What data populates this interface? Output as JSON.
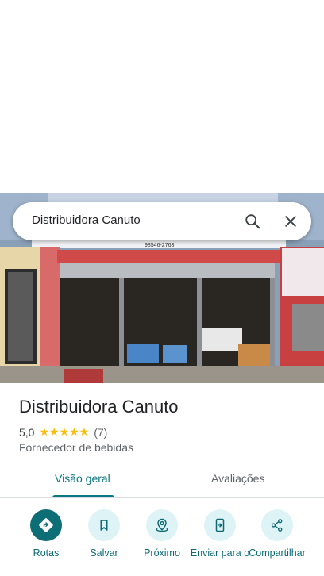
{
  "search": {
    "query": "Distribuidora Canuto"
  },
  "photo": {
    "sign_text": "98546-2763",
    "icons": [
      "storefront-photo"
    ]
  },
  "place": {
    "name": "Distribuidora Canuto",
    "rating": "5,0",
    "stars": "★★★★★",
    "review_count": "(7)",
    "category": "Fornecedor de bebidas"
  },
  "tabs": [
    {
      "label": "Visão geral",
      "active": true
    },
    {
      "label": "Avaliações",
      "active": false
    }
  ],
  "actions": [
    {
      "label": "Rotas",
      "icon": "directions-icon"
    },
    {
      "label": "Salvar",
      "icon": "bookmark-icon"
    },
    {
      "label": "Próximo",
      "icon": "nearby-icon"
    },
    {
      "label": "Enviar para o",
      "icon": "send-to-phone-icon"
    },
    {
      "label": "Compartilhar",
      "icon": "share-icon"
    }
  ],
  "colors": {
    "accent": "#0b7782",
    "action_bg": "#def3f5",
    "primary_action": "#0d6e76",
    "star": "#fbbc04"
  }
}
